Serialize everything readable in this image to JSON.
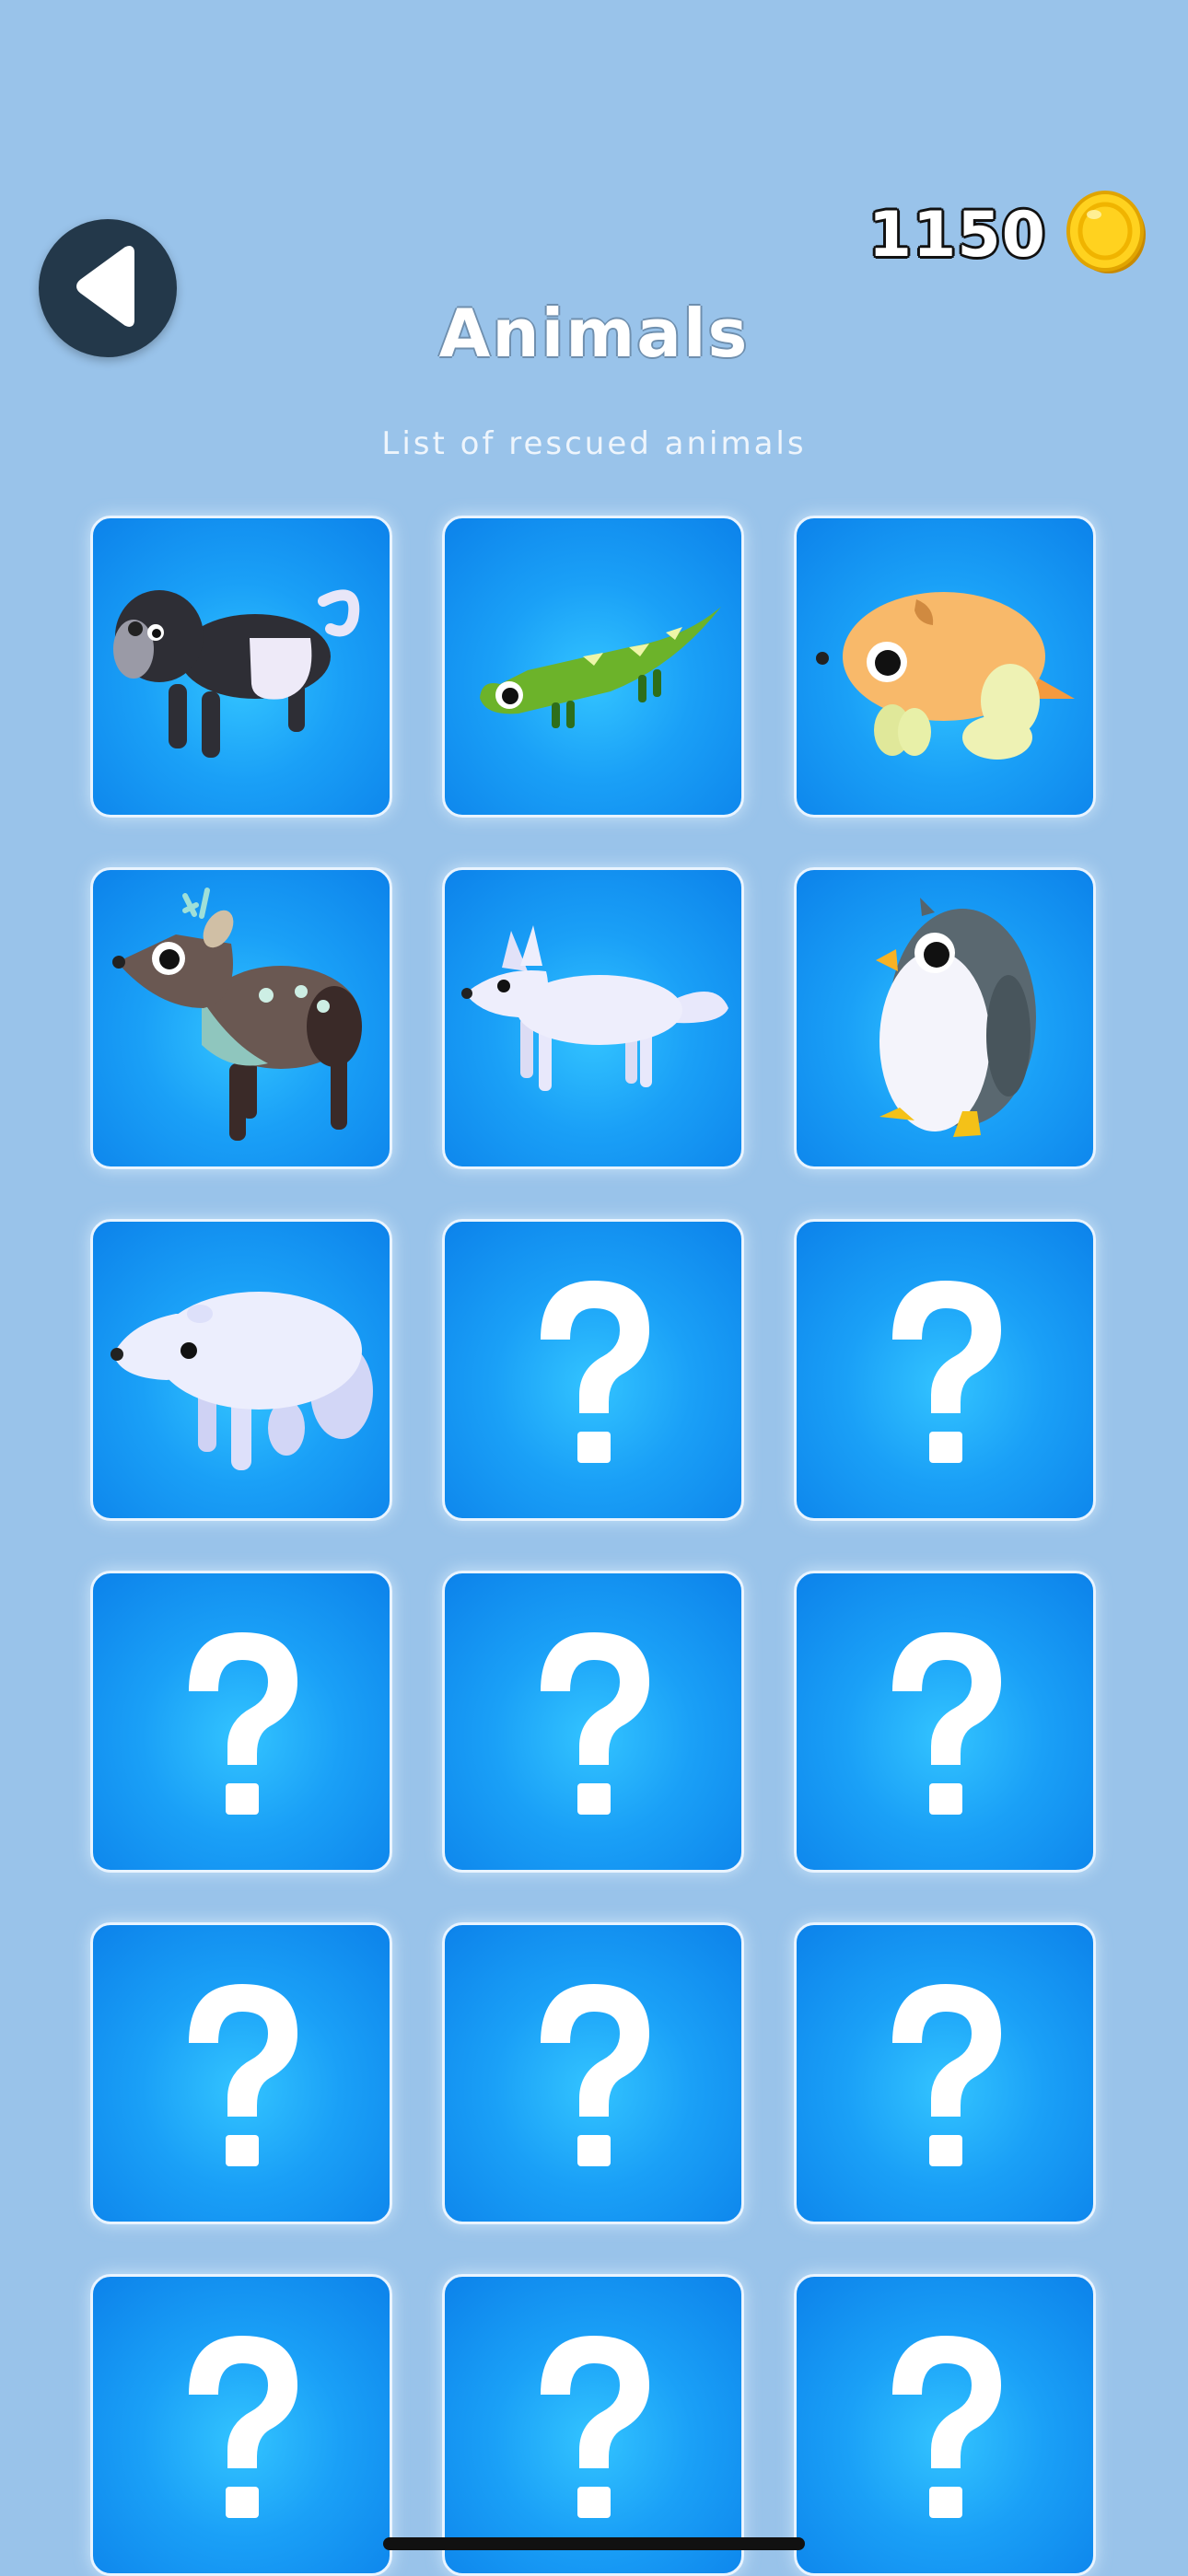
{
  "header": {
    "back_icon": "back-arrow-icon",
    "coin_count": "1150",
    "coin_icon": "gold-coin-icon"
  },
  "page": {
    "title": "Animals",
    "subtitle": "List of rescued animals"
  },
  "animals": [
    {
      "icon": "gorilla-icon",
      "unlocked": true
    },
    {
      "icon": "lizard-icon",
      "unlocked": true
    },
    {
      "icon": "hamster-icon",
      "unlocked": true
    },
    {
      "icon": "deer-icon",
      "unlocked": true
    },
    {
      "icon": "arctic-fox-icon",
      "unlocked": true
    },
    {
      "icon": "penguin-icon",
      "unlocked": true
    },
    {
      "icon": "polar-bear-icon",
      "unlocked": true
    },
    {
      "icon": "question-mark-icon",
      "unlocked": false
    },
    {
      "icon": "question-mark-icon",
      "unlocked": false
    },
    {
      "icon": "question-mark-icon",
      "unlocked": false
    },
    {
      "icon": "question-mark-icon",
      "unlocked": false
    },
    {
      "icon": "question-mark-icon",
      "unlocked": false
    },
    {
      "icon": "question-mark-icon",
      "unlocked": false
    },
    {
      "icon": "question-mark-icon",
      "unlocked": false
    },
    {
      "icon": "question-mark-icon",
      "unlocked": false
    },
    {
      "icon": "question-mark-icon",
      "unlocked": false
    },
    {
      "icon": "question-mark-icon",
      "unlocked": false
    },
    {
      "icon": "question-mark-icon",
      "unlocked": false
    }
  ],
  "colors": {
    "background": "#99c3ea",
    "tile": "#1aa0f7",
    "back_button": "#23384a",
    "coin": "#f5c518"
  }
}
